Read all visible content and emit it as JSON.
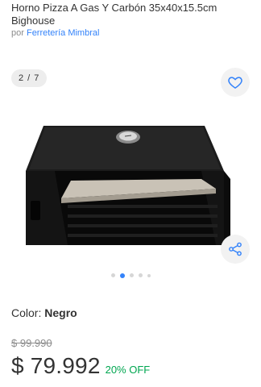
{
  "product": {
    "title": "Horno Pizza A Gas Y Carbón 35x40x15.5cm Bighouse",
    "seller_prefix": "por",
    "seller_name": "Ferretería Mimbral"
  },
  "gallery": {
    "counter": "2 / 7",
    "favorite_icon": "heart-icon",
    "share_icon": "share-icon",
    "dots_total": 5,
    "dots_active_index": 1
  },
  "variant": {
    "label": "Color:",
    "value": "Negro"
  },
  "price": {
    "original": "$ 99.990",
    "current": "$ 79.992",
    "discount": "20% OFF"
  },
  "colors": {
    "accent": "#3483fa",
    "discount": "#00a650",
    "text": "#333333",
    "muted": "#8c8c8c"
  }
}
